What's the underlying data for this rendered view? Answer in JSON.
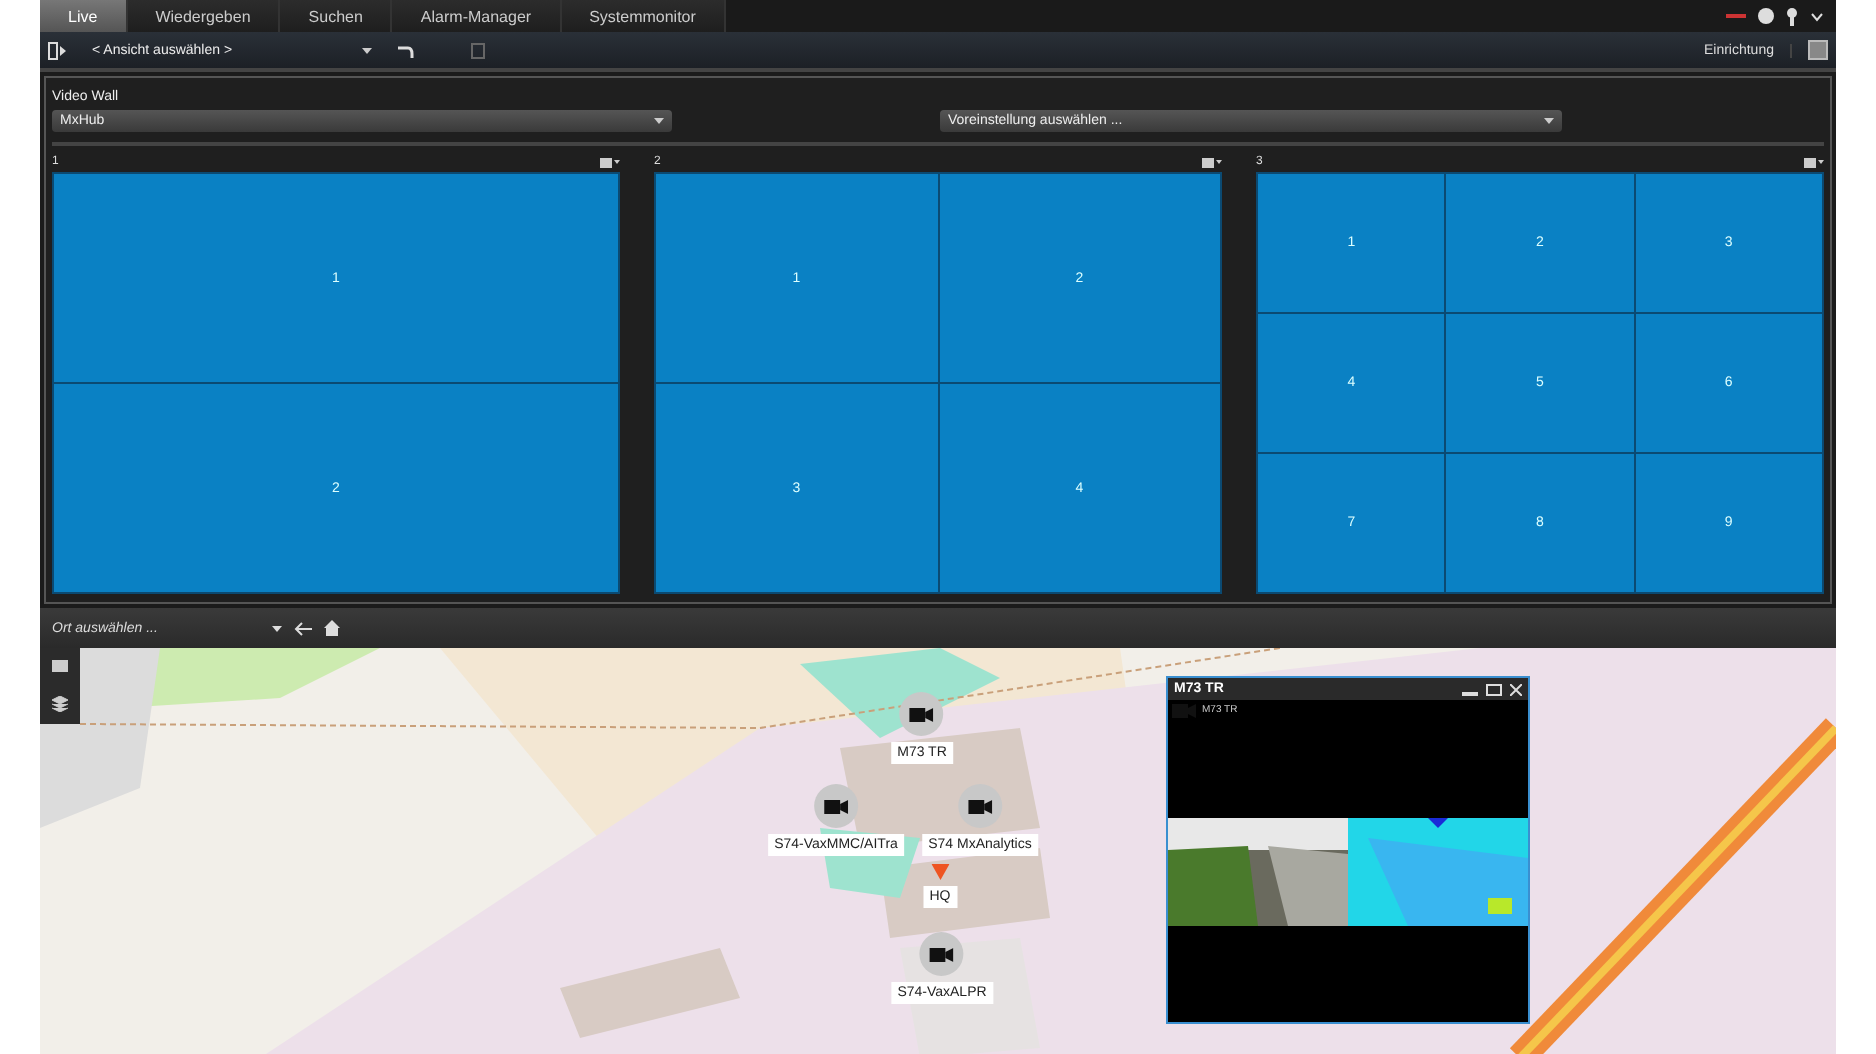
{
  "tabs": [
    {
      "label": "Live",
      "selected": true
    },
    {
      "label": "Wiedergeben",
      "selected": false
    },
    {
      "label": "Suchen",
      "selected": false
    },
    {
      "label": "Alarm-Manager",
      "selected": false
    },
    {
      "label": "Systemmonitor",
      "selected": false
    }
  ],
  "toolbar": {
    "view_select": "< Ansicht auswählen >",
    "setup_button": "Einrichtung"
  },
  "video_wall": {
    "title": "Video Wall",
    "wall_select": "MxHub",
    "preset_select": "Voreinstellung auswählen ...",
    "monitors": [
      {
        "label": "1",
        "tiles": [
          "1",
          "2"
        ]
      },
      {
        "label": "2",
        "tiles": [
          "1",
          "2",
          "3",
          "4"
        ]
      },
      {
        "label": "3",
        "tiles": [
          "1",
          "2",
          "3",
          "4",
          "5",
          "6",
          "7",
          "8",
          "9"
        ]
      }
    ]
  },
  "map": {
    "location_select": "Ort auswählen ...",
    "markers": [
      {
        "kind": "camera",
        "label": "M73 TR"
      },
      {
        "kind": "camera",
        "label": "S74-VaxMMC/AITra"
      },
      {
        "kind": "camera",
        "label": "S74 MxAnalytics"
      },
      {
        "kind": "pin",
        "label": "HQ"
      },
      {
        "kind": "camera",
        "label": "S74-VaxALPR"
      }
    ],
    "video_window": {
      "title": "M73 TR",
      "camera_label": "M73 TR"
    }
  }
}
